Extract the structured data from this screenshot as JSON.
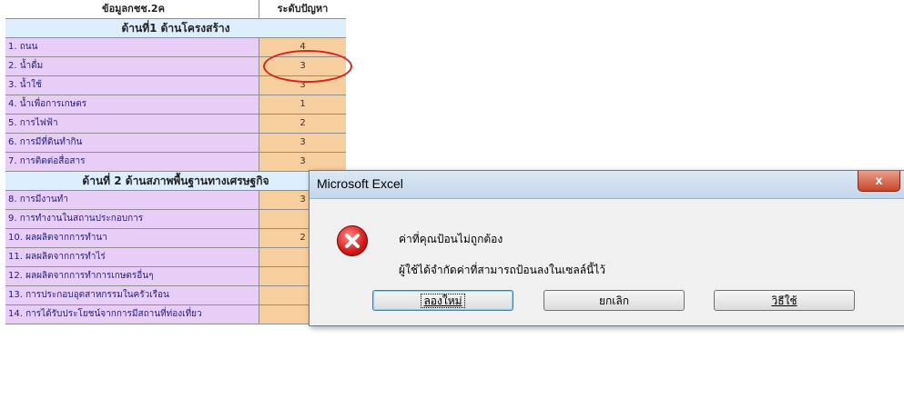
{
  "sheet": {
    "header": {
      "name": "ข้อมูลกชช.2ค",
      "value": "ระดับปัญหา"
    },
    "rows": [
      {
        "type": "section",
        "name": "ด้านที่1 ด้านโครงสร้าง"
      },
      {
        "type": "item",
        "name": "1. ถนน",
        "value": "4"
      },
      {
        "type": "item",
        "name": "2. น้ำดื่ม",
        "value": "3"
      },
      {
        "type": "item",
        "name": "3. น้ำใช้",
        "value": "3"
      },
      {
        "type": "item",
        "name": "4. น้ำเพื่อการเกษตร",
        "value": "1"
      },
      {
        "type": "item",
        "name": "5. การไฟฟ้า",
        "value": "2"
      },
      {
        "type": "item",
        "name": "6. การมีที่ดินทำกิน",
        "value": "3"
      },
      {
        "type": "item",
        "name": "7. การติดต่อสื่อสาร",
        "value": "3"
      },
      {
        "type": "section",
        "name": "ด้านที่ 2 ด้านสภาพพื้นฐานทางเศรษฐกิจ"
      },
      {
        "type": "item",
        "name": "8. การมีงานทำ",
        "value": "3"
      },
      {
        "type": "item",
        "name": "9. การทำงานในสถานประกอบการ",
        "value": ""
      },
      {
        "type": "item",
        "name": "10. ผลผลิตจากการทำนา",
        "value": "2"
      },
      {
        "type": "item",
        "name": "11. ผลผลิตจากการทำไร่",
        "value": ""
      },
      {
        "type": "item",
        "name": "12. ผลผลิตจากการทำการเกษตรอื่นๆ",
        "value": ""
      },
      {
        "type": "item",
        "name": "13. การประกอบอุตสาหกรรมในครัวเรือน",
        "value": ""
      },
      {
        "type": "item",
        "name": "14. การได้รับประโยชน์จากการมีสถานที่ท่องเที่ยว",
        "value": ""
      }
    ]
  },
  "dialog": {
    "title": "Microsoft Excel",
    "close_symbol": "x",
    "message": "ค่าที่คุณป้อนไม่ถูกต้อง",
    "detail": "ผู้ใช้ได้จำกัดค่าที่สามารถป้อนลงในเซลล์นี้ไว้",
    "buttons": {
      "retry": "ลองใหม่",
      "cancel": "ยกเลิก",
      "help": "วิธีใช้"
    }
  }
}
